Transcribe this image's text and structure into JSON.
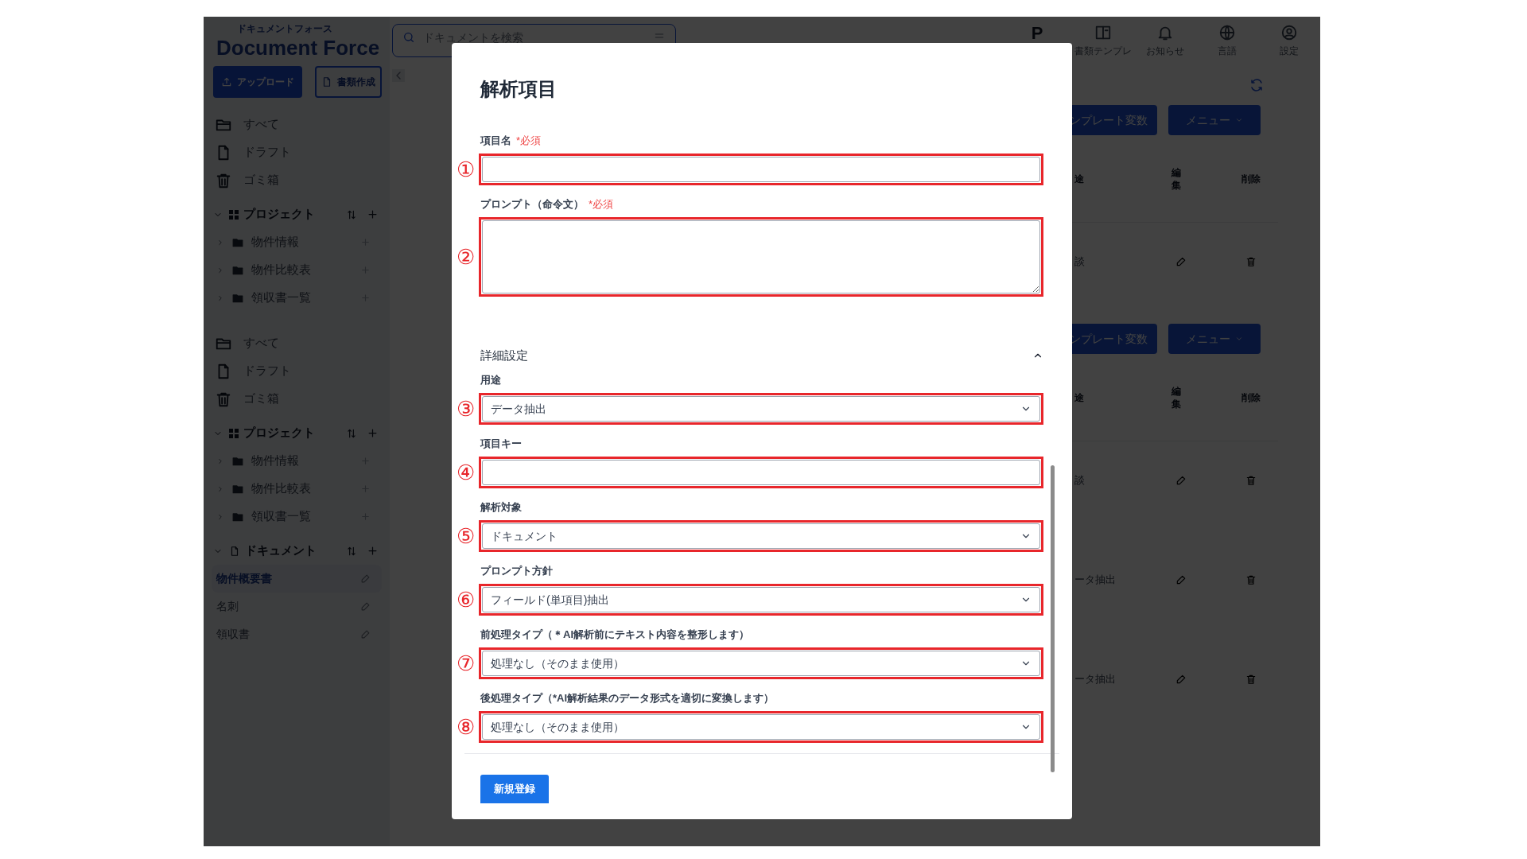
{
  "sidebar": {
    "logo": {
      "kana": "ドキュメントフォース",
      "name": "Document Force"
    },
    "buttons": [
      {
        "label": "アップロード",
        "kind": "primary"
      },
      {
        "label": "書類作成",
        "kind": "outline"
      }
    ],
    "blocks": [
      {
        "kind": "nav",
        "items": [
          {
            "label": "すべて"
          },
          {
            "label": "ドラフト"
          },
          {
            "label": "ゴミ箱"
          }
        ]
      },
      {
        "kind": "projects",
        "title": "プロジェクト",
        "expanded": true,
        "items": [
          {
            "label": "物件情報"
          },
          {
            "label": "物件比較表"
          },
          {
            "label": "領収書一覧"
          }
        ]
      },
      {
        "kind": "nav",
        "items": [
          {
            "label": "すべて"
          },
          {
            "label": "ドラフト"
          },
          {
            "label": "ゴミ箱"
          }
        ]
      },
      {
        "kind": "projects",
        "title": "プロジェクト",
        "expanded": true,
        "items": [
          {
            "label": "物件情報"
          },
          {
            "label": "物件比較表"
          },
          {
            "label": "領収書一覧"
          }
        ]
      },
      {
        "kind": "documents",
        "title": "ドキュメント",
        "expanded": true,
        "items": [
          {
            "label": "物件概要書",
            "selected": true
          },
          {
            "label": "名刺",
            "selected": false
          },
          {
            "label": "領収書",
            "selected": false
          }
        ]
      }
    ]
  },
  "header": {
    "search": {
      "placeholder": "ドキュメントを検索"
    },
    "badge": "P",
    "icons": [
      {
        "label": "書類テンプレ"
      },
      {
        "label": "お知らせ"
      },
      {
        "label": "言語"
      },
      {
        "label": "設定"
      }
    ]
  },
  "main": {
    "sections": [
      {
        "buttons": [
          "ンプレート変数",
          "メニュー"
        ],
        "columns": [
          "途",
          "編集",
          "削除"
        ],
        "rows": [
          {
            "cell": "談"
          }
        ]
      },
      {
        "buttons": [
          "ンプレート変数",
          "メニュー"
        ],
        "columns": [
          "途",
          "編集",
          "削除"
        ],
        "rows": [
          {
            "cell": "談"
          },
          {
            "cell": "ータ抽出"
          },
          {
            "cell": "ータ抽出"
          }
        ]
      }
    ]
  },
  "dialog": {
    "title": "解析項目",
    "fields": [
      {
        "label": "項目名",
        "required": "*必須",
        "kind": "text",
        "marker": "①"
      },
      {
        "label": "プロンプト（命令文）",
        "required": "*必須",
        "kind": "textarea",
        "marker": "②"
      }
    ],
    "section": {
      "title": "詳細設定",
      "expanded": true
    },
    "advanced_fields": [
      {
        "label": "用途",
        "kind": "select",
        "value": "データ抽出",
        "marker": "③"
      },
      {
        "label": "項目キー",
        "kind": "text",
        "marker": "④"
      },
      {
        "label": "解析対象",
        "kind": "select",
        "value": "ドキュメント",
        "marker": "⑤"
      },
      {
        "label": "プロンプト方針",
        "kind": "select",
        "value": "フィールド(単項目)抽出",
        "marker": "⑥"
      },
      {
        "label": "前処理タイプ（＊AI解析前にテキスト内容を整形します）",
        "kind": "select",
        "value": "処理なし（そのまま使用）",
        "marker": "⑦"
      },
      {
        "label": "後処理タイプ（*AI解析結果のデータ形式を適切に変換します）",
        "kind": "select",
        "value": "処理なし（そのまま使用）",
        "marker": "⑧"
      }
    ],
    "submit": "新規登録"
  }
}
